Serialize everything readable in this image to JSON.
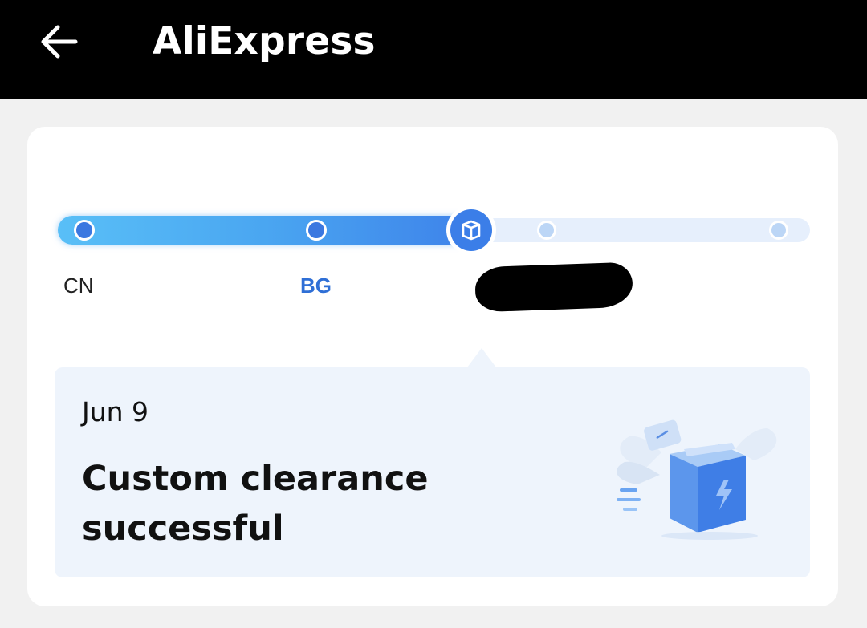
{
  "appbar": {
    "title": "AliExpress",
    "back_icon": "arrow-left-icon"
  },
  "tracking": {
    "progress_fraction": 0.55,
    "nodes": [
      {
        "label": "CN",
        "state": "done"
      },
      {
        "label": "BG",
        "state": "done",
        "highlighted": true
      },
      {
        "label": "",
        "state": "current",
        "icon": "package-icon"
      },
      {
        "label": "",
        "state": "future"
      },
      {
        "label": "",
        "state": "future"
      }
    ],
    "colors": {
      "accent": "#3b7ee8",
      "track_start": "#59bff7",
      "track_end": "#3e83ea",
      "track_bg": "#e6effc",
      "future_node": "#bcd6f6",
      "highlight_label": "#2f6fd6"
    }
  },
  "event": {
    "date": "Jun 9",
    "status": "Custom clearance successful",
    "illustration": "flying-parcel-illustration",
    "panel_color": "#eef4fc"
  }
}
